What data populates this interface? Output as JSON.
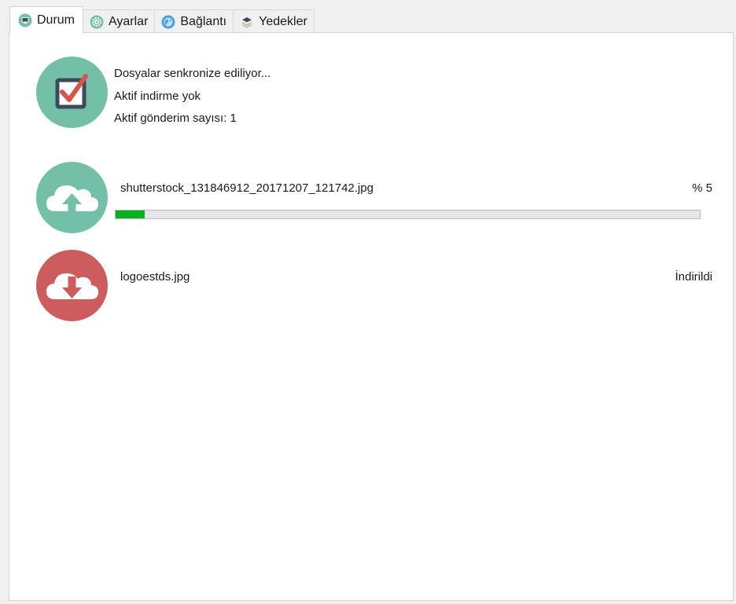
{
  "tabs": [
    {
      "label": "Durum",
      "icon": "monitor-icon",
      "active": true
    },
    {
      "label": "Ayarlar",
      "icon": "gear-icon",
      "active": false
    },
    {
      "label": "Bağlantı",
      "icon": "globe-icon",
      "active": false
    },
    {
      "label": "Yedekler",
      "icon": "layers-icon",
      "active": false
    }
  ],
  "status": {
    "icon": "checkbox-check-icon",
    "line1": "Dosyalar senkronize ediliyor...",
    "line2": "Aktif indirme yok",
    "line3": "Aktif gönderim sayısı: 1"
  },
  "upload": {
    "icon": "cloud-upload-icon",
    "filename": "shutterstock_131846912_20171207_121742.jpg",
    "percent_text": "% 5",
    "progress": 0.05
  },
  "download": {
    "icon": "cloud-download-icon",
    "filename": "logoestds.jpg",
    "state_text": "İndirildi"
  },
  "colors": {
    "upload_circle": "#74bfa7",
    "download_circle": "#cc5c5e",
    "progress_fill": "#06b025",
    "status_frame": "#3d4a5c",
    "status_check": "#d9534f"
  }
}
